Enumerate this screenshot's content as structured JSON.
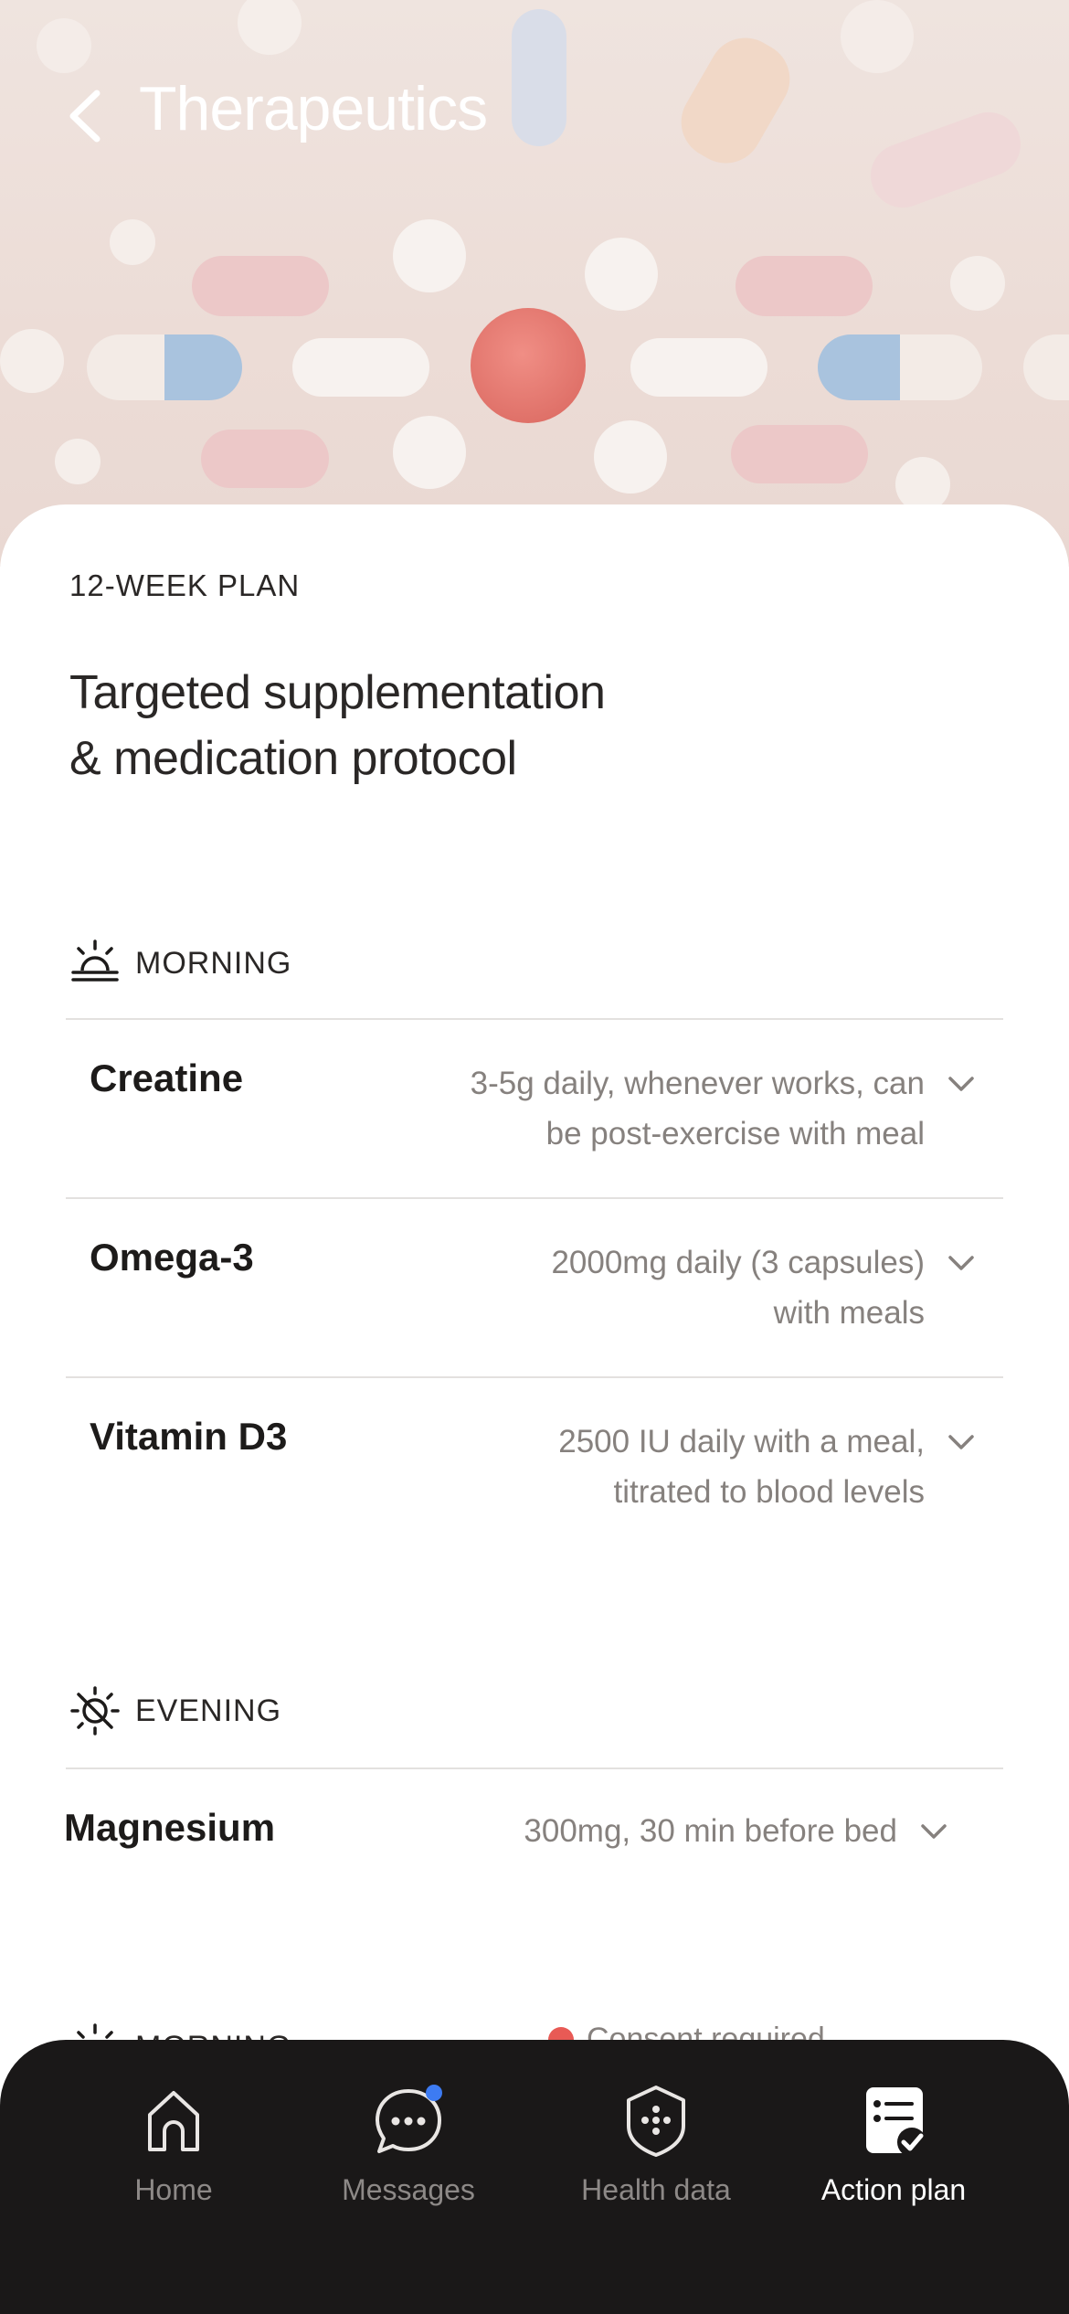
{
  "header": {
    "title": "Therapeutics",
    "back_icon": "chevron-left-icon"
  },
  "plan": {
    "eyebrow": "12-WEEK PLAN",
    "headline_line1": "Targeted supplementation",
    "headline_line2": "& medication protocol"
  },
  "sections": [
    {
      "label": "MORNING",
      "icon": "sunrise-icon",
      "items": [
        {
          "name": "Creatine",
          "dose_line1": "3-5g daily, whenever works, can",
          "dose_line2": "be post-exercise with meal"
        },
        {
          "name": "Omega-3",
          "dose_line1": "2000mg daily (3 capsules)",
          "dose_line2": "with meals"
        },
        {
          "name": "Vitamin D3",
          "dose_line1": "2500 IU daily with a meal,",
          "dose_line2": "titrated to blood levels"
        }
      ]
    },
    {
      "label": "EVENING",
      "icon": "sun-off-icon",
      "items": [
        {
          "name": "Magnesium",
          "dose_line1": "300mg, 30 min before bed"
        }
      ]
    },
    {
      "label": "MORNING",
      "icon": "sunrise-icon",
      "status": "Consent required"
    }
  ],
  "tabbar": {
    "tabs": [
      {
        "label": "Home",
        "icon": "home-icon"
      },
      {
        "label": "Messages",
        "icon": "chat-bubble-icon",
        "badge": true
      },
      {
        "label": "Health data",
        "icon": "shield-dots-icon"
      },
      {
        "label": "Action plan",
        "icon": "checklist-icon",
        "active": true
      }
    ]
  },
  "colors": {
    "accent_badge": "#3d7bf2",
    "status_dot": "#e85a55",
    "tabbar_bg": "#1a1818",
    "muted_text": "#86817e"
  }
}
